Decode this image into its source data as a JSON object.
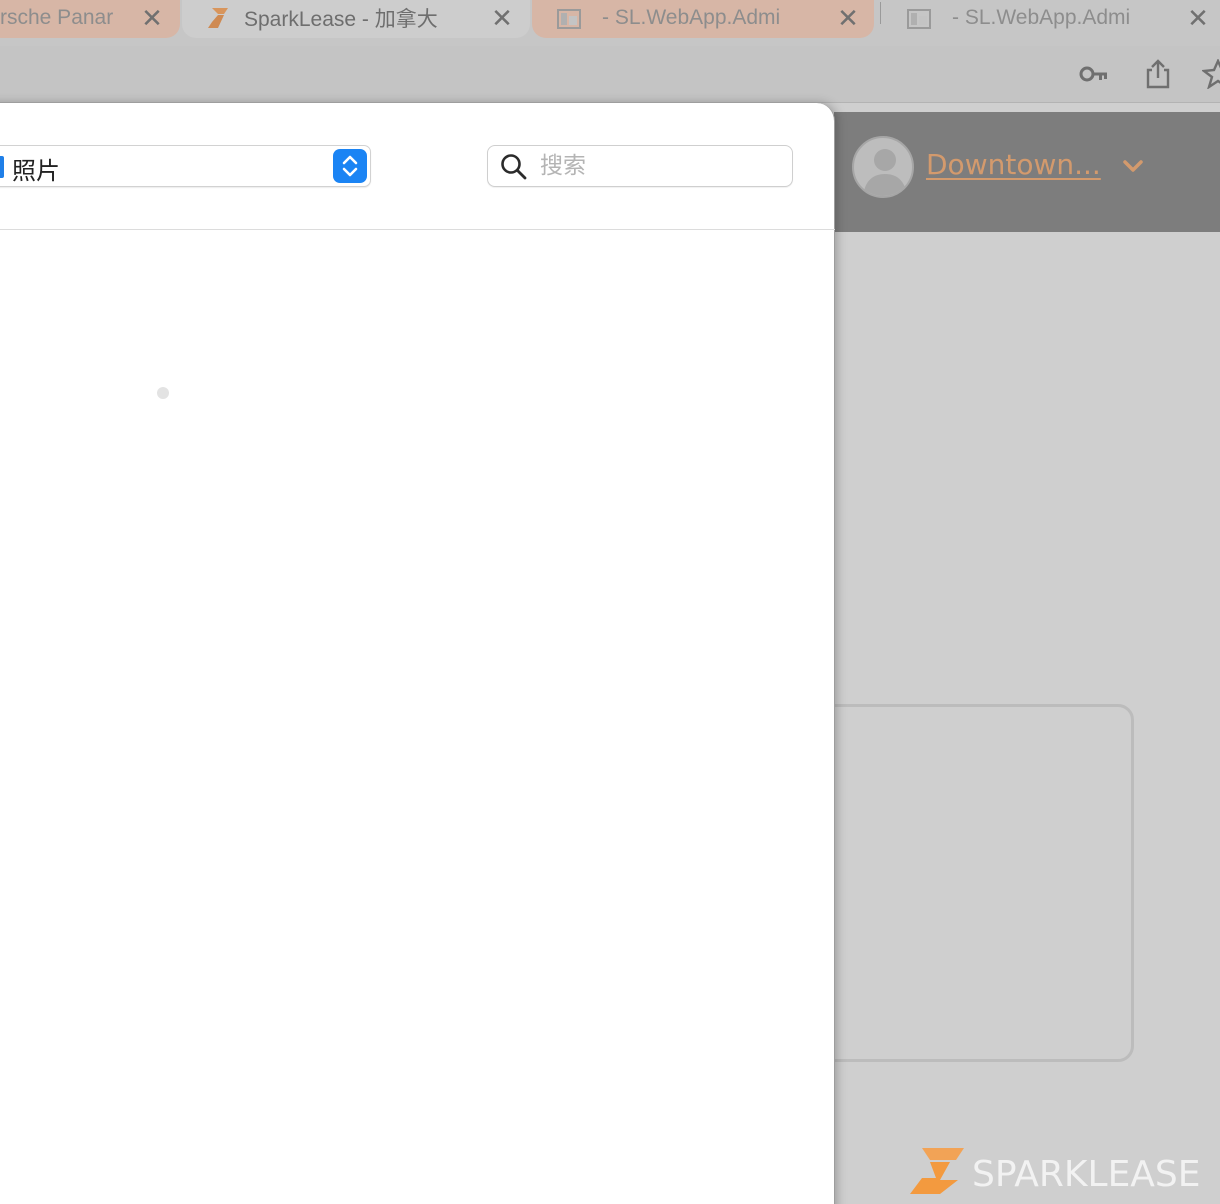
{
  "browser": {
    "tabs": [
      {
        "title": "rsche Panar",
        "active": false
      },
      {
        "title": "SparkLease - 加拿大",
        "active": true
      },
      {
        "title": "- SL.WebApp.Admi",
        "active": false
      },
      {
        "title": "- SL.WebApp.Admi",
        "active": false
      }
    ],
    "toolbar_icons": [
      "key-icon",
      "share-icon",
      "bookmark-star-icon"
    ]
  },
  "picker": {
    "source_label": "照片",
    "search_placeholder": "搜索",
    "search_value": ""
  },
  "page": {
    "location_name": "Downtown...",
    "brand_name": "SPARKLEASE"
  },
  "colors": {
    "accent_orange": "#f5a04a",
    "picker_blue": "#1b84f4",
    "header_bg": "#7d7d7d"
  }
}
